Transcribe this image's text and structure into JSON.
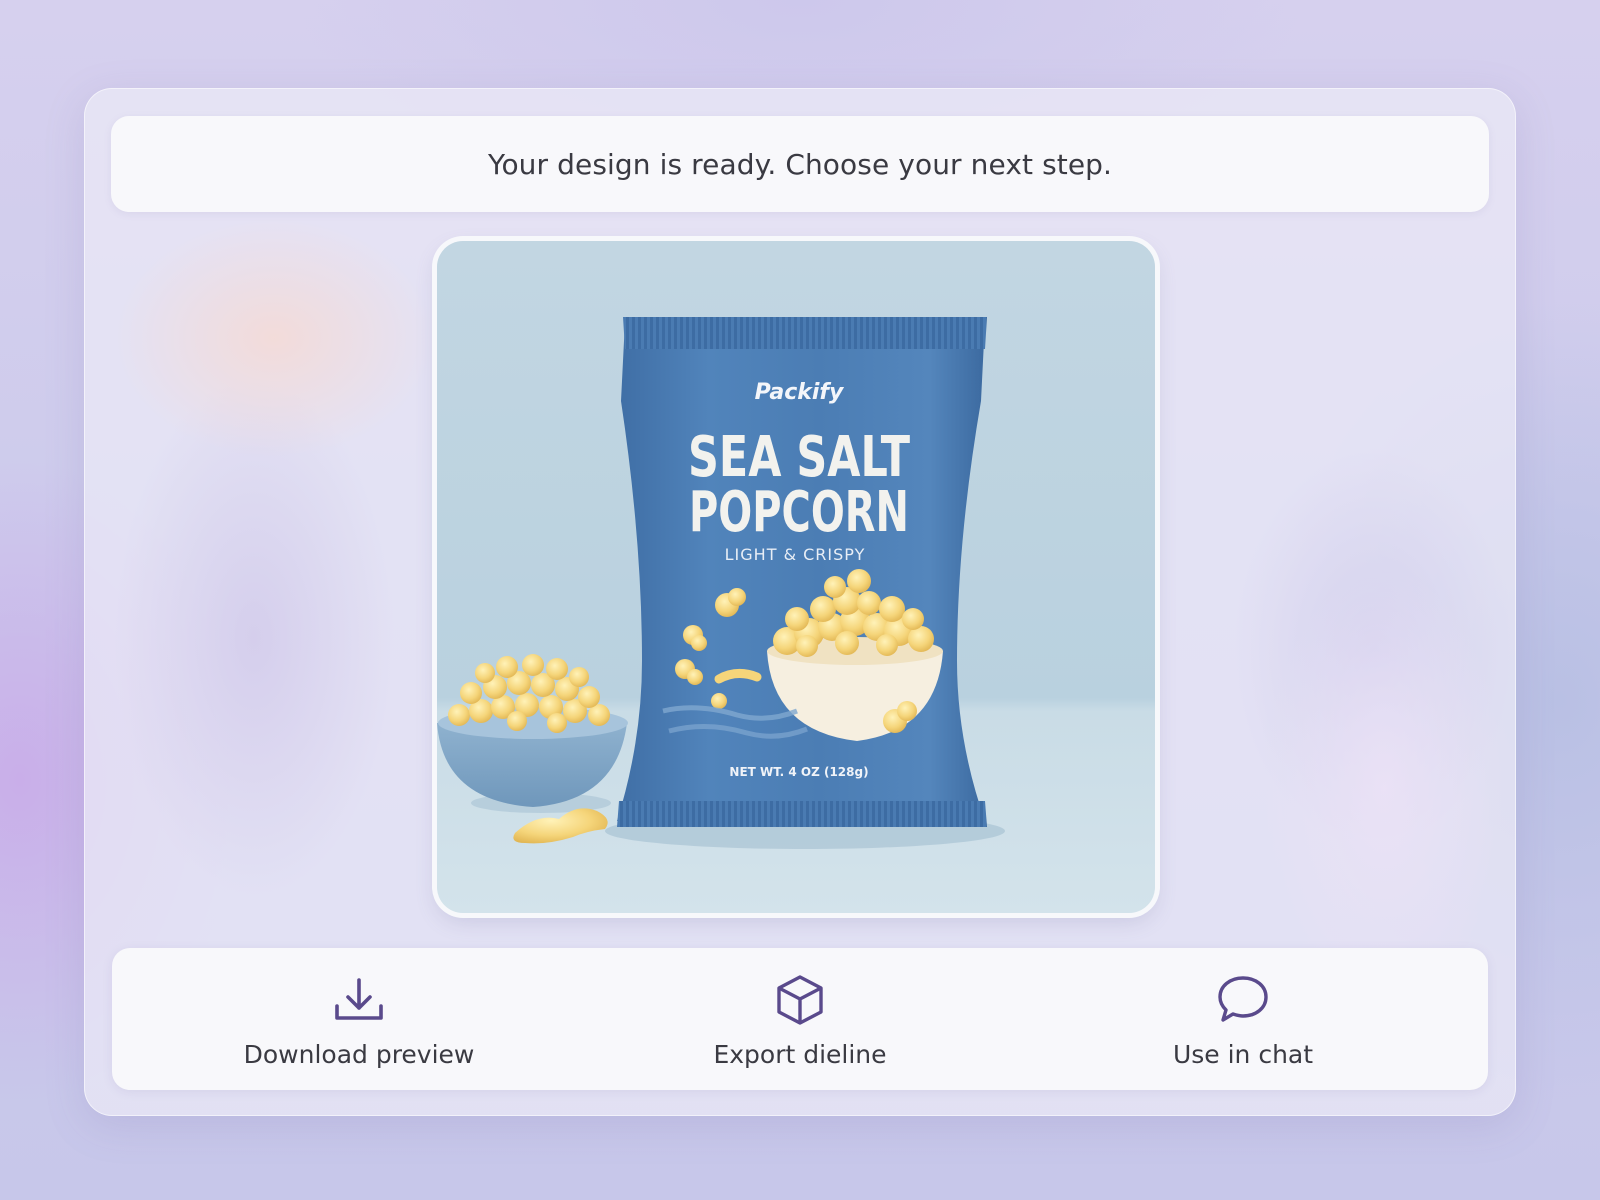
{
  "banner": {
    "message": "Your design is ready. Choose your next step."
  },
  "preview": {
    "brand": "Packify",
    "product_line1": "SEA SALT",
    "product_line2": "POPCORN",
    "tagline": "LIGHT & CRISPY",
    "net_weight": "NET WT. 4 OZ (128g)",
    "bag_color": "#4b7cb3",
    "background_color": "#c9dbe6"
  },
  "actions": [
    {
      "label": "Download preview",
      "icon": "download-icon"
    },
    {
      "label": "Export dieline",
      "icon": "cube-icon"
    },
    {
      "label": "Use in chat",
      "icon": "chat-bubble-icon"
    }
  ],
  "colors": {
    "accent": "#5a4a8c",
    "text": "#3a3a42"
  }
}
